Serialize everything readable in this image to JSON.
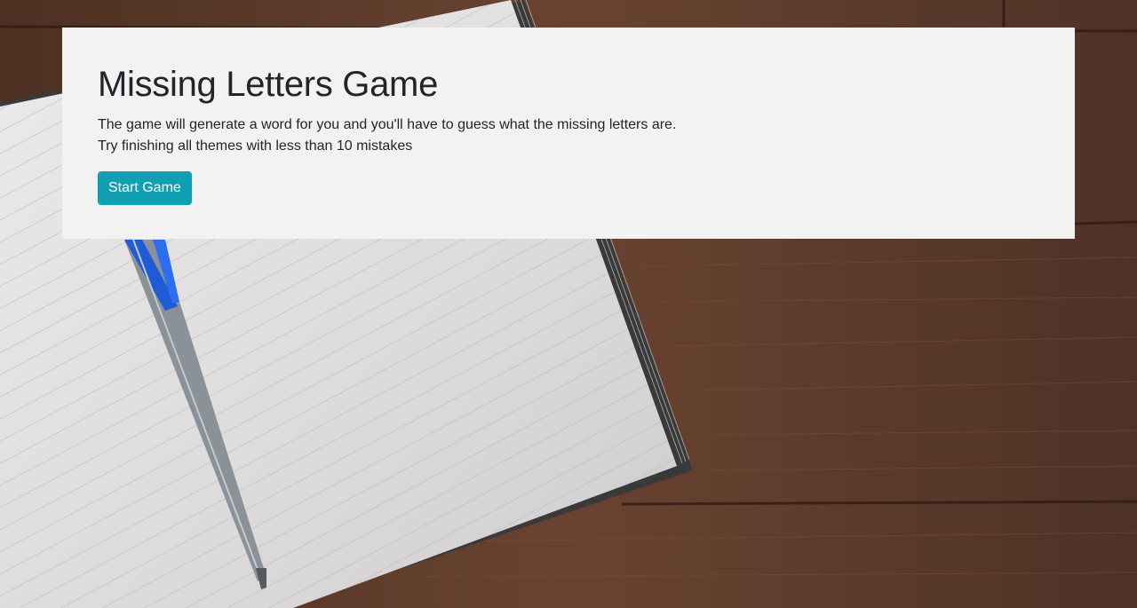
{
  "game": {
    "title": "Missing Letters Game",
    "description_line1": "The game will generate a word for you and you'll have to guess what the missing letters are.",
    "description_line2": "Try finishing all themes with less than 10 mistakes",
    "start_button_label": "Start Game"
  },
  "background": {
    "description_colors": {
      "wood": "#5a3a28",
      "notebook_page": "#e6e4e4",
      "pen_blue": "#1f5bd6",
      "pen_barrel": "#8a9298"
    }
  },
  "colors": {
    "panel": "#f2f2f2",
    "text": "#212529",
    "button": "#11a0b3",
    "button_text": "#ffffff"
  }
}
